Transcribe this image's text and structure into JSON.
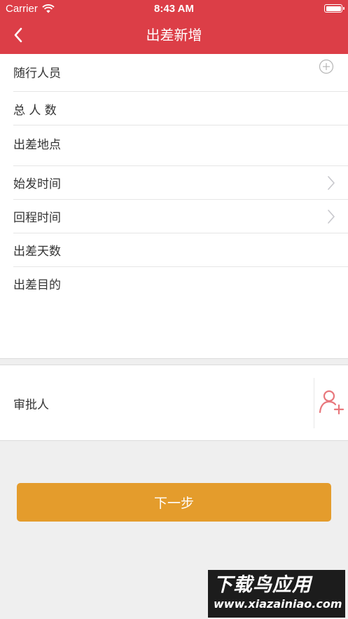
{
  "status_bar": {
    "carrier": "Carrier",
    "time": "8:43 AM",
    "wifi_icon": "wifi-icon",
    "battery_icon": "battery-icon"
  },
  "nav": {
    "title": "出差新增",
    "back_icon": "chevron-left-icon"
  },
  "form": {
    "rows": [
      {
        "label": "随行人员",
        "accessory": "plus-circle-icon"
      },
      {
        "label": "总 人 数"
      },
      {
        "label": "出差地点"
      },
      {
        "label": "始发时间",
        "accessory": "chevron-right-icon"
      },
      {
        "label": "回程时间",
        "accessory": "chevron-right-icon"
      },
      {
        "label": "出差天数"
      },
      {
        "label": "出差目的"
      }
    ]
  },
  "approver": {
    "label": "审批人",
    "add_icon": "add-user-icon"
  },
  "next_button": {
    "label": "下一步"
  },
  "watermark": {
    "title": "下载鸟应用",
    "url": "www.xiazainiao.com"
  },
  "colors": {
    "header": "#dc3e47",
    "primary_button": "#e49c2c",
    "background": "#efefef",
    "add_user_icon": "#e8777c"
  }
}
